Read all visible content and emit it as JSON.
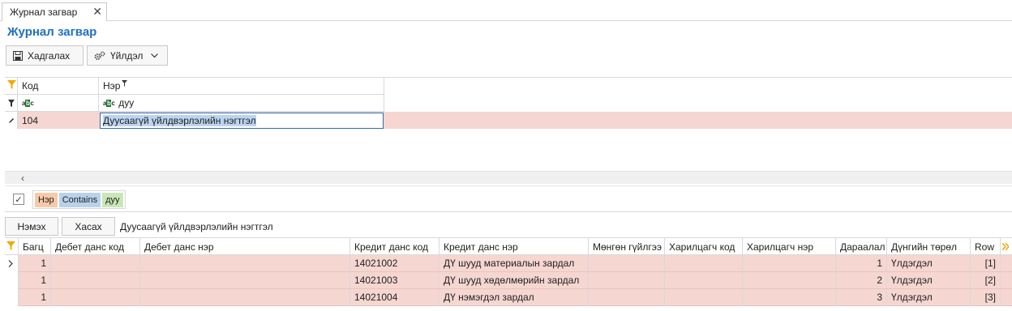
{
  "tab": {
    "label": "Журнал загвар",
    "close": "✕"
  },
  "page_title": "Журнал загвар",
  "toolbar": {
    "save_label": "Хадгалах",
    "action_label": "Үйлдэл"
  },
  "grid1": {
    "col_code": "Код",
    "col_name": "Нэр",
    "filter_code": "",
    "filter_name": "дуу",
    "row": {
      "code": "104",
      "name": "Дуусаагүй үйлдвэрлэлийн нэгтгэл"
    }
  },
  "filter_panel": {
    "field": "Нэр",
    "operator": "Contains",
    "value": "дуу"
  },
  "toolbar2": {
    "add_label": "Нэмэх",
    "delete_label": "Хасах",
    "caption": "Дуусаагүй үйлдвэрлэлийн нэгтгэл"
  },
  "grid2": {
    "headers": [
      "Багц",
      "Дебет данс код",
      "Дебет данс нэр",
      "Кредит данс код",
      "Кредит данс нэр",
      "Мөнгөн гүйлгээ",
      "Харилцагч код",
      "Харилцагч нэр",
      "Дараалал",
      "Дүнгийн төрөл",
      "Row"
    ],
    "rows": [
      {
        "batch": "1",
        "debit_code": "",
        "debit_name": "",
        "credit_code": "14021002",
        "credit_name": "ДҮ шууд материалын зардал",
        "cash": "",
        "partner_code": "",
        "partner_name": "",
        "order": "1",
        "amount_type": "Үлдэгдэл",
        "row": "[1]"
      },
      {
        "batch": "1",
        "debit_code": "",
        "debit_name": "",
        "credit_code": "14021003",
        "credit_name": "ДҮ шууд хөдөлмөрийн зардал",
        "cash": "",
        "partner_code": "",
        "partner_name": "",
        "order": "2",
        "amount_type": "Үлдэгдэл",
        "row": "[2]"
      },
      {
        "batch": "1",
        "debit_code": "",
        "debit_name": "",
        "credit_code": "14021004",
        "credit_name": "ДҮ нэмэгдэл зардал",
        "cash": "",
        "partner_code": "",
        "partner_name": "",
        "order": "3",
        "amount_type": "Үлдэгдэл",
        "row": "[3]"
      }
    ]
  },
  "colors": {
    "accent": "#1f6fc5",
    "selected_row": "#f5d6d1",
    "filter_icon": "#f2a900"
  }
}
